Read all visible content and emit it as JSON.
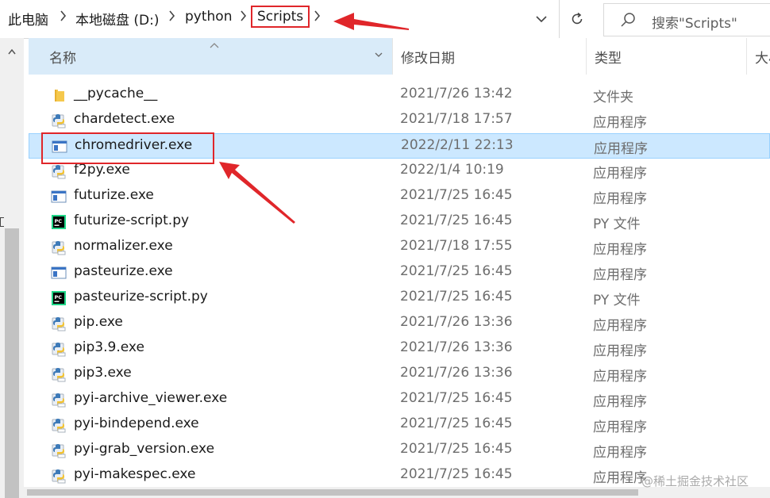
{
  "address_bar": {
    "breadcrumbs": [
      "此电脑",
      "本地磁盘 (D:)",
      "python",
      "Scripts"
    ]
  },
  "search": {
    "placeholder": "搜索\"Scripts\""
  },
  "columns": {
    "name": "名称",
    "date": "修改日期",
    "type": "类型",
    "size": "大小"
  },
  "files": [
    {
      "name": "__pycache__",
      "date": "2021/7/26 13:42",
      "type": "文件夹",
      "icon": "folder-icon"
    },
    {
      "name": "chardetect.exe",
      "date": "2021/7/18 17:57",
      "type": "应用程序",
      "icon": "python-exe-icon"
    },
    {
      "name": "chromedriver.exe",
      "date": "2022/2/11 22:13",
      "type": "应用程序",
      "icon": "app-window-icon",
      "selected": true
    },
    {
      "name": "f2py.exe",
      "date": "2022/1/4 10:19",
      "type": "应用程序",
      "icon": "python-exe-icon"
    },
    {
      "name": "futurize.exe",
      "date": "2021/7/25 16:45",
      "type": "应用程序",
      "icon": "app-window-icon"
    },
    {
      "name": "futurize-script.py",
      "date": "2021/7/25 16:45",
      "type": "PY 文件",
      "icon": "pycharm-file-icon"
    },
    {
      "name": "normalizer.exe",
      "date": "2021/7/18 17:55",
      "type": "应用程序",
      "icon": "python-exe-icon"
    },
    {
      "name": "pasteurize.exe",
      "date": "2021/7/25 16:45",
      "type": "应用程序",
      "icon": "app-window-icon"
    },
    {
      "name": "pasteurize-script.py",
      "date": "2021/7/25 16:45",
      "type": "PY 文件",
      "icon": "pycharm-file-icon"
    },
    {
      "name": "pip.exe",
      "date": "2021/7/26 13:36",
      "type": "应用程序",
      "icon": "python-exe-icon"
    },
    {
      "name": "pip3.9.exe",
      "date": "2021/7/26 13:36",
      "type": "应用程序",
      "icon": "python-exe-icon"
    },
    {
      "name": "pip3.exe",
      "date": "2021/7/26 13:36",
      "type": "应用程序",
      "icon": "python-exe-icon"
    },
    {
      "name": "pyi-archive_viewer.exe",
      "date": "2021/7/25 16:45",
      "type": "应用程序",
      "icon": "python-exe-icon"
    },
    {
      "name": "pyi-bindepend.exe",
      "date": "2021/7/25 16:45",
      "type": "应用程序",
      "icon": "python-exe-icon"
    },
    {
      "name": "pyi-grab_version.exe",
      "date": "2021/7/25 16:45",
      "type": "应用程序",
      "icon": "python-exe-icon"
    },
    {
      "name": "pyi-makespec.exe",
      "date": "2021/7/25 16:45",
      "type": "应用程序",
      "icon": "python-exe-icon"
    }
  ],
  "watermark": "@稀土掘金技术社区",
  "colors": {
    "selection": "#cce8ff",
    "header_highlight": "#d9ebf9",
    "annotation": "#e0262a"
  }
}
